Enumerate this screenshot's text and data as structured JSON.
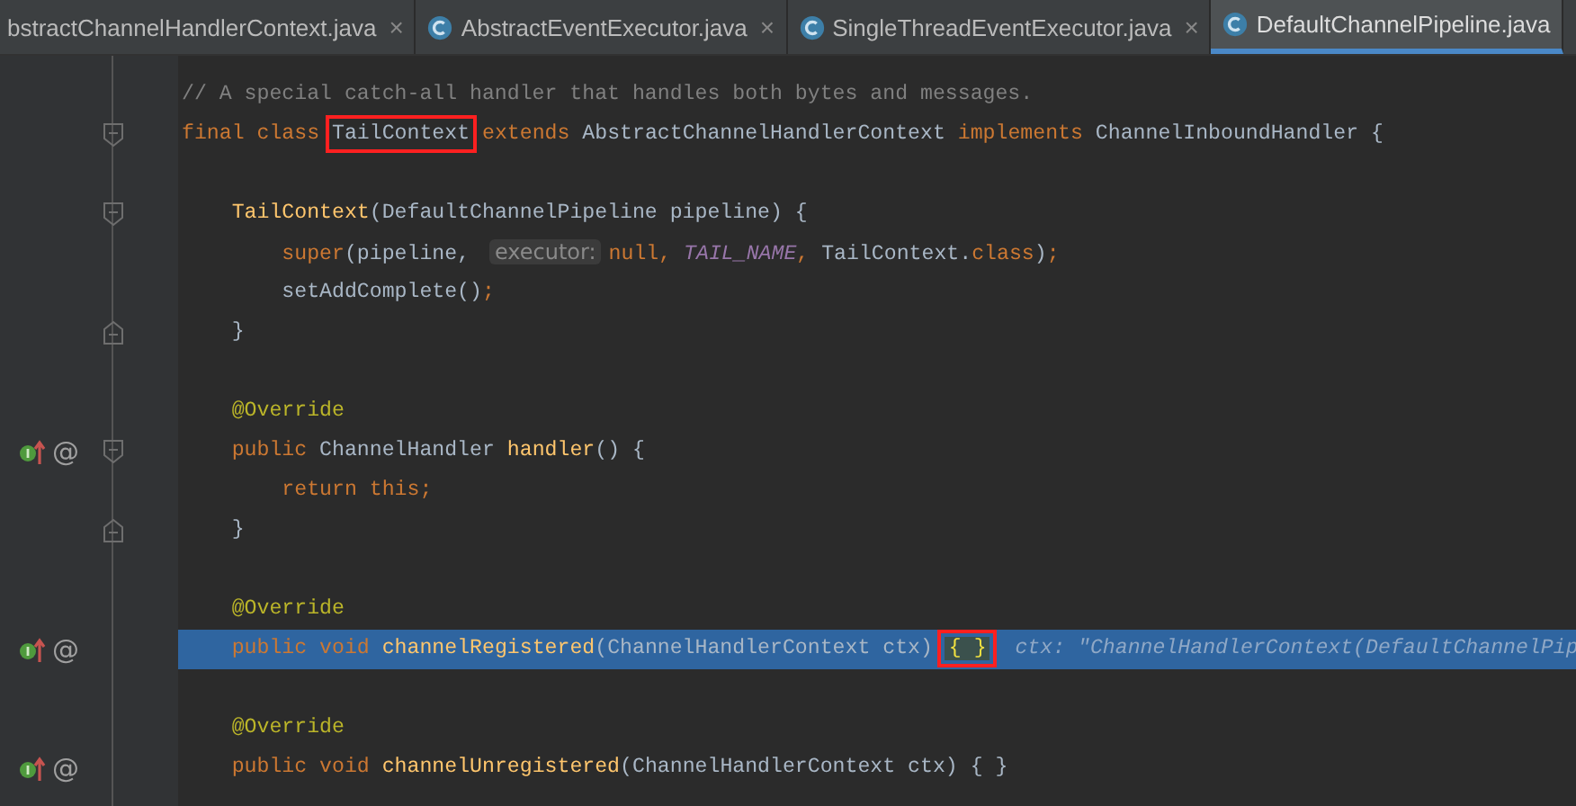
{
  "tabs": [
    {
      "label": "bstractChannelHandlerContext.java",
      "selected": false,
      "icon": false,
      "close": "×"
    },
    {
      "label": "AbstractEventExecutor.java",
      "selected": false,
      "icon": true,
      "close": "×"
    },
    {
      "label": "SingleThreadEventExecutor.java",
      "selected": false,
      "icon": true,
      "close": "×"
    },
    {
      "label": "DefaultChannelPipeline.java",
      "selected": true,
      "icon": true
    }
  ],
  "lines": [
    {
      "selected": false,
      "tokens": [
        {
          "kind": "comment",
          "text": "// A special catch-all handler that handles both bytes and messages."
        }
      ]
    },
    {
      "selected": false,
      "fold_start": true,
      "tokens": [
        {
          "kind": "keyword",
          "text": "final class "
        },
        {
          "kind": "plain",
          "text": "TailContext",
          "boxed": true
        },
        {
          "kind": "keyword",
          "text": " extends "
        },
        {
          "kind": "plain",
          "text": "AbstractChannelHandlerContext "
        },
        {
          "kind": "keyword",
          "text": "implements "
        },
        {
          "kind": "plain",
          "text": "ChannelInboundHandler {"
        }
      ]
    },
    {
      "selected": false
    },
    {
      "selected": false,
      "fold_start": true,
      "tokens": [
        {
          "kind": "method",
          "text": "    TailContext"
        },
        {
          "kind": "plain",
          "text": "(DefaultChannelPipeline pipeline) {"
        }
      ]
    },
    {
      "selected": false,
      "tokens": [
        {
          "kind": "keyword",
          "text": "        super"
        },
        {
          "kind": "plain",
          "text": "(pipeline, "
        },
        {
          "kind": "hint",
          "text": "executor:"
        },
        {
          "kind": "keyword",
          "text": "null, "
        },
        {
          "kind": "constant",
          "text": "TAIL_NAME"
        },
        {
          "kind": "keyword",
          "text": ", "
        },
        {
          "kind": "plain",
          "text": "TailContext."
        },
        {
          "kind": "keyword",
          "text": "class"
        },
        {
          "kind": "plain",
          "text": ")"
        },
        {
          "kind": "keyword",
          "text": ";"
        }
      ]
    },
    {
      "selected": false,
      "tokens": [
        {
          "kind": "plain",
          "text": "        setAddComplete()"
        },
        {
          "kind": "keyword",
          "text": ";"
        }
      ]
    },
    {
      "selected": false,
      "fold_end": true,
      "tokens": [
        {
          "kind": "plain",
          "text": "    }"
        }
      ]
    },
    {
      "selected": false
    },
    {
      "selected": false,
      "tokens": [
        {
          "kind": "annotation",
          "text": "    @Override"
        }
      ]
    },
    {
      "selected": false,
      "fold_start": true,
      "mark": "@",
      "tokens": [
        {
          "kind": "keyword",
          "text": "    public "
        },
        {
          "kind": "plain",
          "text": "ChannelHandler "
        },
        {
          "kind": "method",
          "text": "handler"
        },
        {
          "kind": "plain",
          "text": "() {"
        }
      ]
    },
    {
      "selected": false,
      "tokens": [
        {
          "kind": "keyword",
          "text": "        return this;"
        }
      ]
    },
    {
      "selected": false,
      "fold_end": true,
      "tokens": [
        {
          "kind": "plain",
          "text": "    }"
        }
      ]
    },
    {
      "selected": false
    },
    {
      "selected": false,
      "tokens": [
        {
          "kind": "annotation",
          "text": "    @Override"
        }
      ]
    },
    {
      "selected": true,
      "mark": "@",
      "tokens": [
        {
          "kind": "keyword",
          "text": "    public void "
        },
        {
          "kind": "method",
          "text": "channelRegistered"
        },
        {
          "kind": "plain",
          "text": "(ChannelHandlerContext ctx) "
        },
        {
          "kind": "brace",
          "text": "{ }",
          "boxed": true
        },
        {
          "kind": "debug",
          "text": "  ctx: \"ChannelHandlerContext(DefaultChannelPip"
        }
      ]
    },
    {
      "selected": false
    },
    {
      "selected": false,
      "tokens": [
        {
          "kind": "annotation",
          "text": "    @Override"
        }
      ]
    },
    {
      "selected": false,
      "mark": "@",
      "tokens": [
        {
          "kind": "keyword",
          "text": "    public void "
        },
        {
          "kind": "method",
          "text": "channelUnregistered"
        },
        {
          "kind": "plain",
          "text": "(ChannelHandlerContext ctx) { }"
        }
      ]
    }
  ]
}
